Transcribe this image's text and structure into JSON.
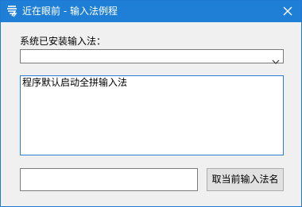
{
  "window": {
    "title": "近在眼前 - 输入法例程",
    "app_icon": "app-logo-icon",
    "close_icon": "close-icon",
    "title_bar_color": "#1f7fd6"
  },
  "ime_selector": {
    "label": "系统已安装输入法：",
    "selected_value": "",
    "arrow_icon": "chevron-down-icon"
  },
  "output_box": {
    "text": "程序默认启动全拼输入法"
  },
  "ime_name_field": {
    "value": ""
  },
  "buttons": {
    "get_current_ime_name": "取当前输入法名"
  }
}
